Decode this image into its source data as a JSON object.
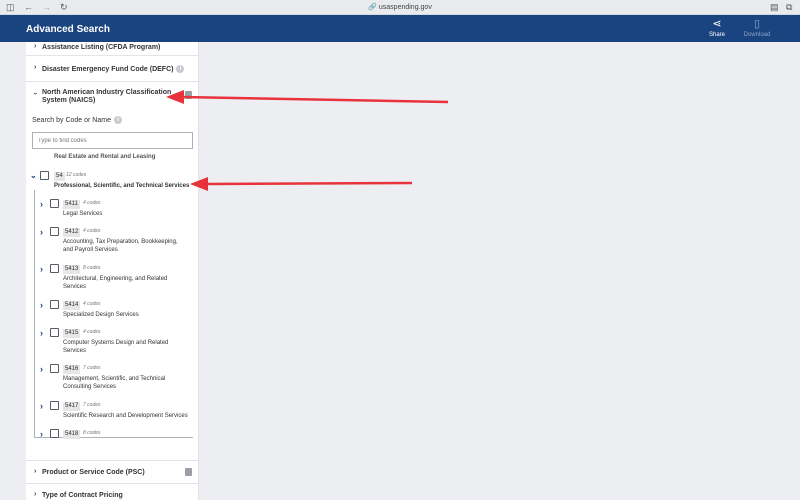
{
  "browser": {
    "url": "usaspending.gov",
    "sidebar_icon": "sidebar-icon",
    "back_icon": "←",
    "forward_icon": "→",
    "reload_icon": "↻"
  },
  "header": {
    "title": "Advanced Search",
    "share_label": "Share",
    "download_label": "Download",
    "brand_color": "#1a4480"
  },
  "filters": {
    "assistance_listing": "Assistance Listing (CFDA Program)",
    "defc": "Disaster Emergency Fund Code (DEFC)",
    "naics_line1": "North American Industry Classification",
    "naics_line2": "System (NAICS)",
    "psc": "Product or Service Code (PSC)",
    "contract_pricing": "Type of Contract Pricing"
  },
  "naics": {
    "search_label": "Search by Code or Name",
    "search_placeholder": "Type to find codes",
    "partial_item": "Real Estate and Rental and Leasing",
    "parent": {
      "code": "54",
      "count": "12 codes",
      "name": "Professional, Scientific, and Technical Services"
    },
    "children": [
      {
        "code": "5411",
        "count": "4 codes",
        "name1": "Legal Services",
        "name2": ""
      },
      {
        "code": "5412",
        "count": "4 codes",
        "name1": "Accounting, Tax Preparation, Bookkeeping,",
        "name2": "and Payroll Services"
      },
      {
        "code": "5413",
        "count": "8 codes",
        "name1": "Architectural, Engineering, and Related",
        "name2": "Services"
      },
      {
        "code": "5414",
        "count": "4 codes",
        "name1": "Specialized Design Services",
        "name2": ""
      },
      {
        "code": "5415",
        "count": "4 codes",
        "name1": "Computer Systems Design and Related",
        "name2": "Services"
      },
      {
        "code": "5416",
        "count": "7 codes",
        "name1": "Management, Scientific, and Technical",
        "name2": "Consulting Services"
      },
      {
        "code": "5417",
        "count": "7 codes",
        "name1": "Scientific Research and Development Services",
        "name2": ""
      },
      {
        "code": "5418",
        "count": "8 codes",
        "name1": "",
        "name2": ""
      }
    ]
  },
  "annotation_color": "#e8333c"
}
